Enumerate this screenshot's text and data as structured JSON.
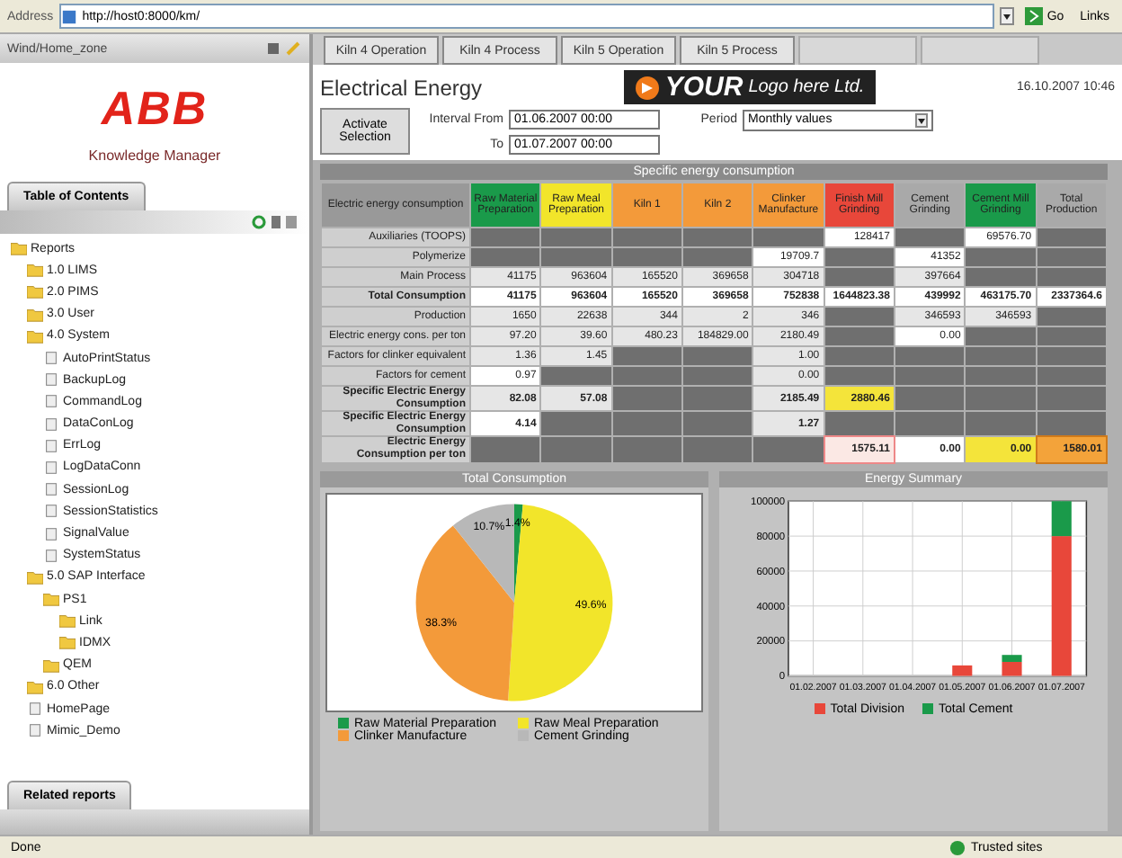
{
  "address_bar": {
    "label": "Address",
    "url": "http://host0:8000/km/",
    "go": "Go",
    "links": "Links"
  },
  "sidebar": {
    "title": "Wind/Home_zone",
    "logo": "ABB",
    "product": "Knowledge Manager",
    "toc_tab": "Table of Contents",
    "related_tab": "Related reports",
    "tree": [
      {
        "label": "Reports",
        "kind": "folder",
        "children": [
          {
            "label": "1.0 LIMS",
            "kind": "folder"
          },
          {
            "label": "2.0 PIMS",
            "kind": "folder"
          },
          {
            "label": "3.0 User",
            "kind": "folder"
          },
          {
            "label": "4.0 System",
            "kind": "folder",
            "children": [
              {
                "label": "AutoPrintStatus",
                "kind": "report"
              },
              {
                "label": "BackupLog",
                "kind": "report"
              },
              {
                "label": "CommandLog",
                "kind": "report"
              },
              {
                "label": "DataConLog",
                "kind": "report"
              },
              {
                "label": "ErrLog",
                "kind": "report"
              },
              {
                "label": "LogDataConn",
                "kind": "report"
              },
              {
                "label": "SessionLog",
                "kind": "report"
              },
              {
                "label": "SessionStatistics",
                "kind": "report"
              },
              {
                "label": "SignalValue",
                "kind": "report"
              },
              {
                "label": "SystemStatus",
                "kind": "report"
              }
            ]
          },
          {
            "label": "5.0 SAP Interface",
            "kind": "folder",
            "children": [
              {
                "label": "PS1",
                "kind": "folder",
                "children": [
                  {
                    "label": "Link",
                    "kind": "folder"
                  },
                  {
                    "label": "IDMX",
                    "kind": "folder"
                  }
                ]
              },
              {
                "label": "QEM",
                "kind": "folder"
              }
            ]
          },
          {
            "label": "6.0 Other",
            "kind": "folder"
          },
          {
            "label": "HomePage",
            "kind": "report"
          },
          {
            "label": "Mimic_Demo",
            "kind": "report"
          }
        ]
      }
    ]
  },
  "tabs": [
    {
      "label": "Kiln 4 Operation",
      "selected": false
    },
    {
      "label": "Kiln 4 Process",
      "selected": false
    },
    {
      "label": "Kiln 5 Operation",
      "selected": false
    },
    {
      "label": "Kiln 5 Process",
      "selected": false
    }
  ],
  "report": {
    "title": "Electrical Energy",
    "logo_main": "YOUR",
    "logo_sub": "Logo here Ltd.",
    "timestamp": "16.10.2007 10:46",
    "activate_button": "Activate Selection",
    "from_label": "Interval From",
    "from_value": "01.06.2007 00:00",
    "to_label": "To",
    "to_value": "01.07.2007 00:00",
    "period_label": "Period",
    "period_value": "Monthly values"
  },
  "table": {
    "title": "Specific energy consumption",
    "corner": "Electric energy consumption",
    "columns": [
      {
        "label": "Raw Material Preparation",
        "color": "#1a9a4a"
      },
      {
        "label": "Raw Meal Preparation",
        "color": "#f2e52a"
      },
      {
        "label": "Kiln 1",
        "color": "#f39a3a"
      },
      {
        "label": "Kiln 2",
        "color": "#f39a3a"
      },
      {
        "label": "Clinker Manufacture",
        "color": "#f39a3a"
      },
      {
        "label": "Finish Mill Grinding",
        "color": "#e8473a"
      },
      {
        "label": "Cement Grinding",
        "color": "#a9a9a9"
      },
      {
        "label": "Cement Mill Grinding",
        "color": "#1a9a4a"
      },
      {
        "label": "Total Production",
        "color": "#a9a9a9"
      }
    ],
    "rows": [
      {
        "label": "Auxiliaries (TOOPS)",
        "bold": false,
        "cells": [
          {
            "kind": "dark"
          },
          {
            "kind": "dark"
          },
          {
            "kind": "dark"
          },
          {
            "kind": "dark"
          },
          {
            "kind": "dark"
          },
          {
            "kind": "white",
            "value": "128417"
          },
          {
            "kind": "dark"
          },
          {
            "kind": "white",
            "value": "69576.70"
          },
          {
            "kind": "dark"
          }
        ]
      },
      {
        "label": "Polymerize",
        "bold": false,
        "cells": [
          {
            "kind": "dark"
          },
          {
            "kind": "dark"
          },
          {
            "kind": "dark"
          },
          {
            "kind": "dark"
          },
          {
            "kind": "white",
            "value": "19709.7"
          },
          {
            "kind": "dark"
          },
          {
            "kind": "white",
            "value": "41352"
          },
          {
            "kind": "dark"
          },
          {
            "kind": "dark"
          }
        ]
      },
      {
        "label": "Main Process",
        "bold": false,
        "cells": [
          {
            "kind": "light",
            "value": "41175"
          },
          {
            "kind": "light",
            "value": "963604"
          },
          {
            "kind": "light",
            "value": "165520"
          },
          {
            "kind": "light",
            "value": "369658"
          },
          {
            "kind": "light",
            "value": "304718"
          },
          {
            "kind": "dark"
          },
          {
            "kind": "light",
            "value": "397664"
          },
          {
            "kind": "dark"
          },
          {
            "kind": "dark"
          }
        ]
      },
      {
        "label": "Total Consumption",
        "bold": true,
        "cells": [
          {
            "kind": "white",
            "value": "41175"
          },
          {
            "kind": "white",
            "value": "963604"
          },
          {
            "kind": "white",
            "value": "165520"
          },
          {
            "kind": "white",
            "value": "369658"
          },
          {
            "kind": "white",
            "value": "752838"
          },
          {
            "kind": "white",
            "value": "1644823.38"
          },
          {
            "kind": "white",
            "value": "439992"
          },
          {
            "kind": "white",
            "value": "463175.70"
          },
          {
            "kind": "white",
            "value": "2337364.6"
          }
        ]
      },
      {
        "label": "Production",
        "bold": false,
        "cells": [
          {
            "kind": "light",
            "value": "1650"
          },
          {
            "kind": "light",
            "value": "22638"
          },
          {
            "kind": "light",
            "value": "344"
          },
          {
            "kind": "light",
            "value": "2"
          },
          {
            "kind": "light",
            "value": "346"
          },
          {
            "kind": "dark"
          },
          {
            "kind": "light",
            "value": "346593"
          },
          {
            "kind": "light",
            "value": "346593"
          },
          {
            "kind": "dark"
          }
        ]
      },
      {
        "label": "Electric energy cons. per ton",
        "bold": false,
        "cells": [
          {
            "kind": "light",
            "value": "97.20"
          },
          {
            "kind": "light",
            "value": "39.60"
          },
          {
            "kind": "light",
            "value": "480.23"
          },
          {
            "kind": "light",
            "value": "184829.00"
          },
          {
            "kind": "light",
            "value": "2180.49"
          },
          {
            "kind": "dark"
          },
          {
            "kind": "white",
            "value": "0.00"
          },
          {
            "kind": "dark"
          },
          {
            "kind": "dark"
          }
        ]
      },
      {
        "label": "Factors for clinker equivalent",
        "bold": false,
        "cells": [
          {
            "kind": "light",
            "value": "1.36"
          },
          {
            "kind": "light",
            "value": "1.45"
          },
          {
            "kind": "dark"
          },
          {
            "kind": "dark"
          },
          {
            "kind": "light",
            "value": "1.00"
          },
          {
            "kind": "dark"
          },
          {
            "kind": "dark"
          },
          {
            "kind": "dark"
          },
          {
            "kind": "dark"
          }
        ]
      },
      {
        "label": "Factors for cement",
        "bold": false,
        "cells": [
          {
            "kind": "white",
            "value": "0.97"
          },
          {
            "kind": "dark"
          },
          {
            "kind": "dark"
          },
          {
            "kind": "dark"
          },
          {
            "kind": "light",
            "value": "0.00"
          },
          {
            "kind": "dark"
          },
          {
            "kind": "dark"
          },
          {
            "kind": "dark"
          },
          {
            "kind": "dark"
          }
        ]
      },
      {
        "label": "Specific Electric Energy Consumption",
        "bold": true,
        "cells": [
          {
            "kind": "light",
            "value": "82.08"
          },
          {
            "kind": "light",
            "value": "57.08"
          },
          {
            "kind": "dark"
          },
          {
            "kind": "dark"
          },
          {
            "kind": "light",
            "value": "2185.49"
          },
          {
            "kind": "yellow",
            "value": "2880.46"
          },
          {
            "kind": "dark"
          },
          {
            "kind": "dark"
          },
          {
            "kind": "dark"
          }
        ]
      },
      {
        "label": "Specific Electric Energy Consumption",
        "bold": true,
        "cells": [
          {
            "kind": "white",
            "value": "4.14"
          },
          {
            "kind": "dark"
          },
          {
            "kind": "dark"
          },
          {
            "kind": "dark"
          },
          {
            "kind": "light",
            "value": "1.27"
          },
          {
            "kind": "dark"
          },
          {
            "kind": "dark"
          },
          {
            "kind": "dark"
          },
          {
            "kind": "dark"
          }
        ]
      },
      {
        "label": "Electric Energy Consumption per ton",
        "bold": true,
        "cells": [
          {
            "kind": "dark"
          },
          {
            "kind": "dark"
          },
          {
            "kind": "dark"
          },
          {
            "kind": "dark"
          },
          {
            "kind": "dark"
          },
          {
            "kind": "pink",
            "value": "1575.11"
          },
          {
            "kind": "white",
            "value": "0.00"
          },
          {
            "kind": "yellow",
            "value": "0.00"
          },
          {
            "kind": "orange",
            "value": "1580.01"
          }
        ]
      }
    ]
  },
  "pie_panel": {
    "title": "Total Consumption",
    "chart_data": {
      "type": "pie",
      "categories": [
        "Raw Material Preparation",
        "Raw Meal Preparation",
        "Clinker Manufacture",
        "Cement Grinding"
      ],
      "values": [
        1.4,
        49.6,
        38.3,
        10.7
      ],
      "colors": [
        "#1a9a4a",
        "#f2e52a",
        "#f39a3a",
        "#b8b8b8"
      ],
      "value_labels": [
        "1.4%",
        "49.6%",
        "38.3%",
        "10.7%"
      ]
    }
  },
  "bar_panel": {
    "title": "Energy Summary",
    "chart_data": {
      "type": "bar",
      "stacked": true,
      "categories": [
        "01.02.2007",
        "01.03.2007",
        "01.04.2007",
        "01.05.2007",
        "01.06.2007",
        "01.07.2007"
      ],
      "series": [
        {
          "name": "Total Division",
          "color": "#e8473a",
          "values": [
            null,
            null,
            null,
            6000,
            8000,
            80000
          ]
        },
        {
          "name": "Total Cement",
          "color": "#1a9a4a",
          "values": [
            null,
            null,
            null,
            null,
            4000,
            20000
          ]
        }
      ],
      "ylim": [
        0,
        100000
      ],
      "grid": true,
      "yticks": [
        0,
        20000,
        40000,
        60000,
        80000,
        100000
      ]
    }
  },
  "status_bar": {
    "left": "Done",
    "zone": "Trusted sites"
  }
}
